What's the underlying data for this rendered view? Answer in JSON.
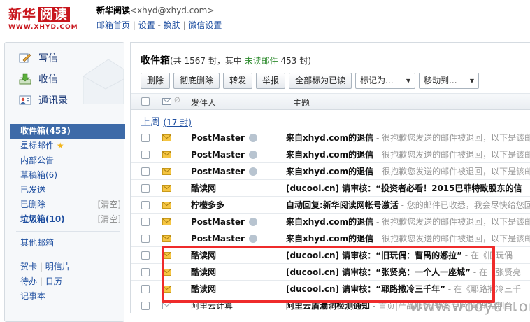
{
  "header": {
    "logo_main": "新华",
    "logo_box": "阅读",
    "logo_sub": "WWW.XHYD.COM",
    "user_name": "新华阅读",
    "user_email": "<xhyd@xhyd.com>",
    "links": [
      "邮箱首页",
      "设置",
      "换肤",
      "微信设置"
    ]
  },
  "actions": {
    "write": "写信",
    "receive": "收信",
    "contacts": "通讯录"
  },
  "folders": {
    "inbox": "收件箱(453)",
    "starred": "星标邮件",
    "announce": "内部公告",
    "drafts": "草稿箱(6)",
    "sent": "已发送",
    "deleted": "已删除",
    "clear1": "[清空]",
    "junk": "垃圾箱(10)",
    "clear2": "[清空]",
    "other": "其他邮箱",
    "card": "贺卡",
    "postcard": "明信片",
    "todo": "待办",
    "calendar": "日历",
    "notebook": "记事本"
  },
  "main": {
    "title": "收件箱",
    "count_prefix": "(共 1567 封，其中 ",
    "unread_label": "未读邮件",
    "count_suffix": " 453 封)",
    "toolbar": [
      "删除",
      "彻底删除",
      "转发",
      "举报",
      "全部标为已读"
    ],
    "mark_as": "标记为...",
    "move_to": "移动到...",
    "col_sender": "发件人",
    "col_subject": "主题",
    "week_label": "上周",
    "week_count": "(17 封)"
  },
  "emails": [
    {
      "sender": "PostMaster",
      "subject": "来自xhyd.com的退信",
      "preview": " - 很抱歉您发送的邮件被退回，以下是该邮件的"
    },
    {
      "sender": "PostMaster",
      "subject": "来自xhyd.com的退信",
      "preview": " - 很抱歉您发送的邮件被退回，以下是该邮件的"
    },
    {
      "sender": "PostMaster",
      "subject": "来自xhyd.com的退信",
      "preview": " - 很抱歉您发送的邮件被退回，以下是该邮件的"
    },
    {
      "sender": "酷读网",
      "subject": "[ducool.cn] 请审核：“投资者必看！2015巴菲特致股东的信",
      "preview": ""
    },
    {
      "sender": "柠檬多多",
      "subject": "自动回复:新华阅读网帐号激活",
      "preview": " - 您的邮件已收悉，我会尽快给您回复"
    },
    {
      "sender": "PostMaster",
      "subject": "来自xhyd.com的退信",
      "preview": " - 很抱歉您发送的邮件被退回，以下是该邮件的"
    },
    {
      "sender": "PostMaster",
      "subject": "来自xhyd.com的退信",
      "preview": " - 很抱歉您发送的邮件被退回，以下是该邮件的"
    },
    {
      "sender": "酷读网",
      "subject": "[ducool.cn] 请审核：“旧玩偶：曹禺的娜拉”",
      "preview": " - 在《旧玩偶"
    },
    {
      "sender": "酷读网",
      "subject": "[ducool.cn] 请审核：“张贤亮：一个人一座城”",
      "preview": " - 在《张贤亮"
    },
    {
      "sender": "酷读网",
      "subject": "[ducool.cn] 请审核：“耶路撒冷三千年”",
      "preview": " - 在《耶路撒冷三千"
    },
    {
      "sender": "阿里云计算",
      "subject": "阿里云盾漏洞检测通知",
      "preview": " - 首页|产品服务|备案专区|管理控制台|"
    }
  ],
  "watermark": "www.wooyun.org"
}
